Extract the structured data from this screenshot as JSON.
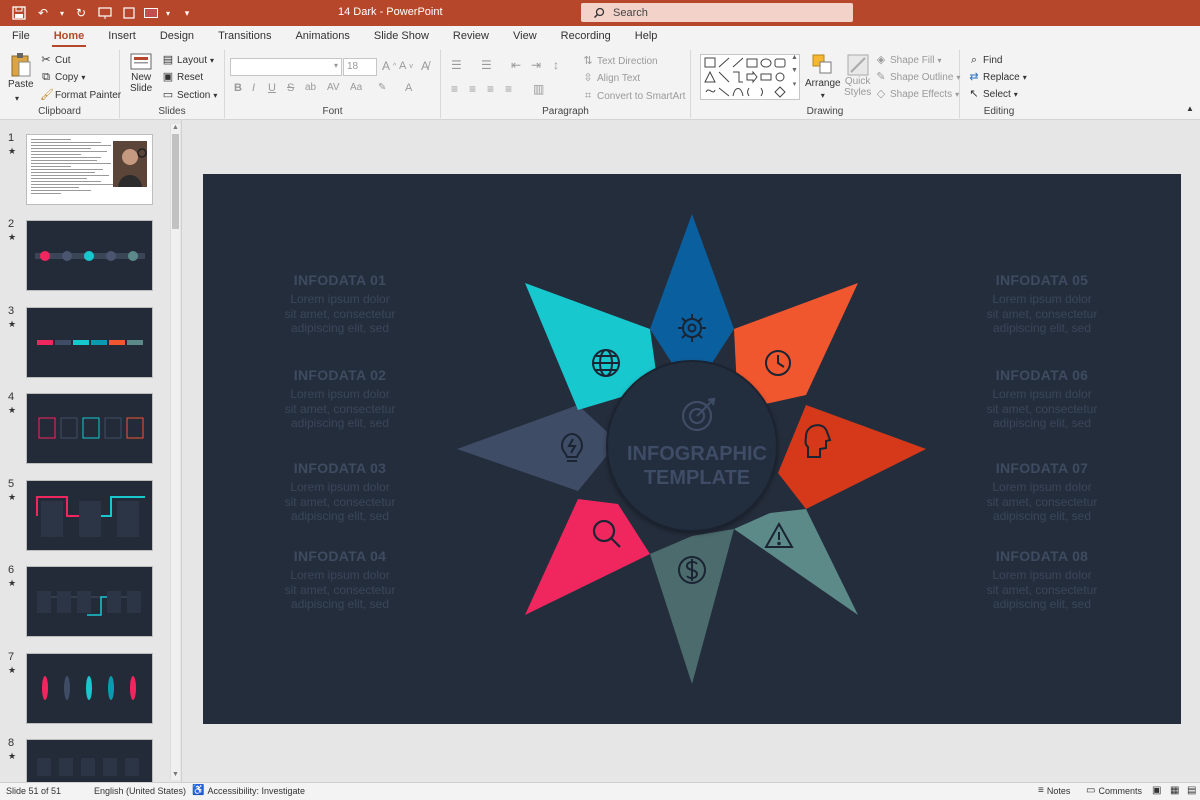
{
  "title_bar": {
    "title": "14 Dark  -  PowerPoint",
    "search_placeholder": "Search"
  },
  "tabs": [
    "File",
    "Home",
    "Insert",
    "Design",
    "Transitions",
    "Animations",
    "Slide Show",
    "Review",
    "View",
    "Recording",
    "Help"
  ],
  "ribbon": {
    "clipboard": {
      "label": "Clipboard",
      "paste": "Paste",
      "cut": "Cut",
      "copy": "Copy",
      "format_painter": "Format Painter"
    },
    "slides": {
      "label": "Slides",
      "new_slide_1": "New",
      "new_slide_2": "Slide",
      "layout": "Layout",
      "reset": "Reset",
      "section": "Section"
    },
    "font": {
      "label": "Font",
      "size": "18"
    },
    "paragraph": {
      "label": "Paragraph",
      "text_direction": "Text Direction",
      "align_text": "Align Text",
      "smartart": "Convert to SmartArt"
    },
    "drawing": {
      "label": "Drawing",
      "arrange": "Arrange",
      "quick_styles_1": "Quick",
      "quick_styles_2": "Styles",
      "shape_fill": "Shape Fill",
      "shape_outline": "Shape Outline",
      "shape_effects": "Shape Effects"
    },
    "editing": {
      "label": "Editing",
      "find": "Find",
      "replace": "Replace",
      "select": "Select"
    }
  },
  "slides_panel": {
    "numbers": [
      "1",
      "2",
      "3",
      "4",
      "5",
      "6",
      "7",
      "8"
    ]
  },
  "slide": {
    "center_line1": "INFOGRAPHIC",
    "center_line2": "TEMPLATE",
    "infos": [
      {
        "title": "INFODATA 01",
        "line1": "Lorem ipsum dolor",
        "line2": "sit amet, consectetur",
        "line3": "adipiscing elit, sed"
      },
      {
        "title": "INFODATA 02",
        "line1": "Lorem ipsum dolor",
        "line2": "sit amet, consectetur",
        "line3": "adipiscing elit, sed"
      },
      {
        "title": "INFODATA 03",
        "line1": "Lorem ipsum dolor",
        "line2": "sit amet, consectetur",
        "line3": "adipiscing elit, sed"
      },
      {
        "title": "INFODATA 04",
        "line1": "Lorem ipsum dolor",
        "line2": "sit amet, consectetur",
        "line3": "adipiscing elit, sed"
      },
      {
        "title": "INFODATA 05",
        "line1": "Lorem ipsum dolor",
        "line2": "sit amet, consectetur",
        "line3": "adipiscing elit, sed"
      },
      {
        "title": "INFODATA 06",
        "line1": "Lorem ipsum dolor",
        "line2": "sit amet, consectetur",
        "line3": "adipiscing elit, sed"
      },
      {
        "title": "INFODATA 07",
        "line1": "Lorem ipsum dolor",
        "line2": "sit amet, consectetur",
        "line3": "adipiscing elit, sed"
      },
      {
        "title": "INFODATA 08",
        "line1": "Lorem ipsum dolor",
        "line2": "sit amet, consectetur",
        "line3": "adipiscing elit, sed"
      }
    ],
    "petal_colors": {
      "top": "#0a5f9e",
      "top_right": "#f1572f",
      "right": "#d5391a",
      "bottom_right": "#5b8a88",
      "bottom": "#4b6b6d",
      "bottom_left": "#f0275e",
      "left": "#3f4c66",
      "top_left": "#17c8cf",
      "background": "#242d3c",
      "center": "#242d3c"
    },
    "petal_icons": [
      "gear-icon",
      "clock-icon",
      "head-icon",
      "warning-icon",
      "dollar-icon",
      "search-icon",
      "lightbulb-icon",
      "globe-icon",
      "target-icon"
    ]
  },
  "status_bar": {
    "slide_count": "Slide 51 of 51",
    "language": "English (United States)",
    "accessibility": "Accessibility: Investigate",
    "notes": "Notes",
    "comments": "Comments"
  }
}
